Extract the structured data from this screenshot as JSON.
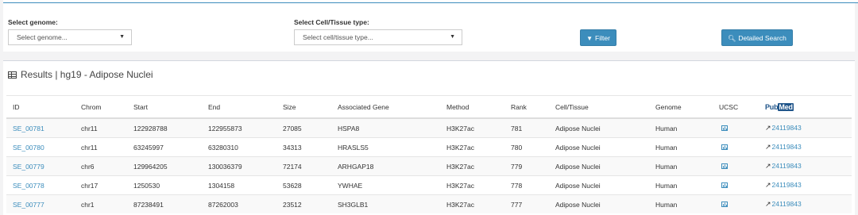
{
  "filters": {
    "genome_label": "Select genome:",
    "genome_value": "Select genome...",
    "cell_label": "Select Cell/Tissue type:",
    "cell_value": "Select cell/tissue type...",
    "filter_button": "Filter",
    "detailed_button": "Detailed Search"
  },
  "results": {
    "title": "Results | hg19 - Adipose Nuclei",
    "headers": [
      "ID",
      "Chrom",
      "Start",
      "End",
      "Size",
      "Associated Gene",
      "Method",
      "Rank",
      "Cell/Tissue",
      "Genome",
      "UCSC"
    ],
    "pubmed_header": {
      "pub": "Pub",
      "med": "Med"
    },
    "rows": [
      {
        "id": "SE_00781",
        "chrom": "chr11",
        "start": "122928788",
        "end": "122955873",
        "size": "27085",
        "gene": "HSPA8",
        "method": "H3K27ac",
        "rank": "781",
        "cell": "Adipose Nuclei",
        "genome": "Human",
        "pubmed": "24119843"
      },
      {
        "id": "SE_00780",
        "chrom": "chr11",
        "start": "63245997",
        "end": "63280310",
        "size": "34313",
        "gene": "HRASLS5",
        "method": "H3K27ac",
        "rank": "780",
        "cell": "Adipose Nuclei",
        "genome": "Human",
        "pubmed": "24119843"
      },
      {
        "id": "SE_00779",
        "chrom": "chr6",
        "start": "129964205",
        "end": "130036379",
        "size": "72174",
        "gene": "ARHGAP18",
        "method": "H3K27ac",
        "rank": "779",
        "cell": "Adipose Nuclei",
        "genome": "Human",
        "pubmed": "24119843"
      },
      {
        "id": "SE_00778",
        "chrom": "chr17",
        "start": "1250530",
        "end": "1304158",
        "size": "53628",
        "gene": "YWHAE",
        "method": "H3K27ac",
        "rank": "778",
        "cell": "Adipose Nuclei",
        "genome": "Human",
        "pubmed": "24119843"
      },
      {
        "id": "SE_00777",
        "chrom": "chr1",
        "start": "87238491",
        "end": "87262003",
        "size": "23512",
        "gene": "SH3GLB1",
        "method": "H3K27ac",
        "rank": "777",
        "cell": "Adipose Nuclei",
        "genome": "Human",
        "pubmed": "24119843"
      }
    ]
  },
  "colors": {
    "accent": "#3c8dbc",
    "pubmed": "#20558a"
  },
  "icons": {
    "filter": "filter-icon",
    "search": "search-icon",
    "results": "table-icon",
    "ucsc": "bar-chart-icon",
    "external": "external-link-icon"
  }
}
